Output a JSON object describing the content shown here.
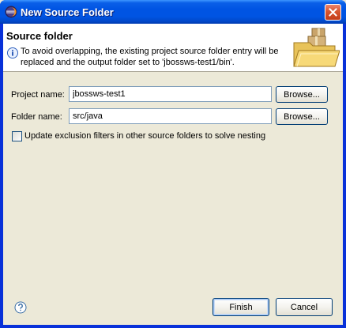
{
  "window": {
    "title": "New Source Folder"
  },
  "banner": {
    "title": "Source folder",
    "message_lines": [
      "To avoid overlapping, the existing project source folder entry will be",
      "replaced and the output folder set to 'jbossws-test1/bin'."
    ]
  },
  "form": {
    "project_name": {
      "label": "Project name:",
      "value": "jbossws-test1",
      "browse_label": "Browse..."
    },
    "folder_name": {
      "label": "Folder name:",
      "value": "src/java",
      "browse_label": "Browse..."
    },
    "update_exclusion": {
      "label": "Update exclusion filters in other source folders to solve nesting",
      "checked": false
    }
  },
  "footer": {
    "finish_label": "Finish",
    "cancel_label": "Cancel"
  },
  "icons": {
    "app": "eclipse-icon",
    "close": "close-icon",
    "info": "info-icon",
    "banner_graphic": "source-folder-wizard-icon",
    "help": "help-icon"
  },
  "colors": {
    "titlebar": "#0054e3",
    "dialog_background": "#ece9d8",
    "banner_background": "#ffffff",
    "input_border": "#7f9db9",
    "button_border": "#003c74",
    "close_button": "#d7552f"
  }
}
